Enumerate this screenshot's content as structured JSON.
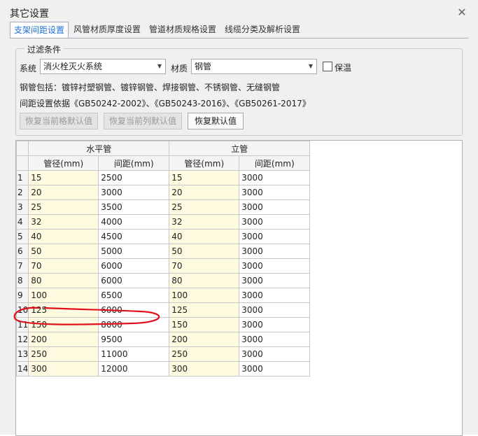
{
  "window": {
    "title": "其它设置",
    "close_icon": "close-icon"
  },
  "tabs": [
    {
      "label": "支架间距设置",
      "active": true
    },
    {
      "label": "风管材质厚度设置",
      "active": false
    },
    {
      "label": "管道材质规格设置",
      "active": false
    },
    {
      "label": "线缆分类及解析设置",
      "active": false
    }
  ],
  "filter": {
    "group_title": "过滤条件",
    "system_label": "系统",
    "system_value": "消火栓灭火系统",
    "material_label": "材质",
    "material_value": "钢管",
    "insulation_label": "保温",
    "insulation_checked": false,
    "includes_text": "钢管包括：镀锌衬塑钢管、镀锌钢管、焊接钢管、不锈钢管、无缝钢管",
    "basis_text": "间距设置依据《GB50242-2002》、《GB50243-2016》、《GB50261-2017》",
    "btn_restore_cell": "恢复当前格默认值",
    "btn_restore_column": "恢复当前列默认值",
    "btn_restore_default": "恢复默认值"
  },
  "table": {
    "group_horizontal": "水平管",
    "group_vertical": "立管",
    "col_diameter": "管径(mm)",
    "col_spacing": "间距(mm)",
    "rows": [
      {
        "idx": "1",
        "h_d": "15",
        "h_s": "2500",
        "v_d": "15",
        "v_s": "3000"
      },
      {
        "idx": "2",
        "h_d": "20",
        "h_s": "3000",
        "v_d": "20",
        "v_s": "3000"
      },
      {
        "idx": "3",
        "h_d": "25",
        "h_s": "3500",
        "v_d": "25",
        "v_s": "3000"
      },
      {
        "idx": "4",
        "h_d": "32",
        "h_s": "4000",
        "v_d": "32",
        "v_s": "3000"
      },
      {
        "idx": "5",
        "h_d": "40",
        "h_s": "4500",
        "v_d": "40",
        "v_s": "3000"
      },
      {
        "idx": "6",
        "h_d": "50",
        "h_s": "5000",
        "v_d": "50",
        "v_s": "3000"
      },
      {
        "idx": "7",
        "h_d": "70",
        "h_s": "6000",
        "v_d": "70",
        "v_s": "3000"
      },
      {
        "idx": "8",
        "h_d": "80",
        "h_s": "6000",
        "v_d": "80",
        "v_s": "3000"
      },
      {
        "idx": "9",
        "h_d": "100",
        "h_s": "6500",
        "v_d": "100",
        "v_s": "3000"
      },
      {
        "idx": "10",
        "h_d": "125",
        "h_s": "6000",
        "v_d": "125",
        "v_s": "3000"
      },
      {
        "idx": "11",
        "h_d": "150",
        "h_s": "8000",
        "v_d": "150",
        "v_s": "3000"
      },
      {
        "idx": "12",
        "h_d": "200",
        "h_s": "9500",
        "v_d": "200",
        "v_s": "3000"
      },
      {
        "idx": "13",
        "h_d": "250",
        "h_s": "11000",
        "v_d": "250",
        "v_s": "3000"
      },
      {
        "idx": "14",
        "h_d": "300",
        "h_s": "12000",
        "v_d": "300",
        "v_s": "3000"
      }
    ]
  },
  "colors": {
    "active_tab": "#1f6fd6",
    "annotation": "#e0101a",
    "diameter_cell_bg": "#fffbe0"
  }
}
